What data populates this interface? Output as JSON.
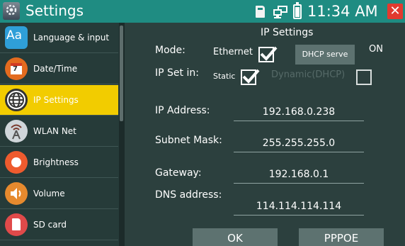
{
  "titlebar": {
    "title": "Settings",
    "time": "11:34 AM",
    "close_symbol": "✕",
    "icons": [
      "settings-app-icon",
      "sd-card-icon",
      "network-icon",
      "battery-icon"
    ]
  },
  "sidebar": {
    "items": [
      {
        "label": "Language & input",
        "icon": "language-icon",
        "active": false
      },
      {
        "label": "Date/Time",
        "icon": "calendar-icon",
        "active": false
      },
      {
        "label": "IP Settings",
        "icon": "globe-icon",
        "active": true
      },
      {
        "label": "WLAN Net",
        "icon": "wlan-icon",
        "active": false
      },
      {
        "label": "Brightness",
        "icon": "brightness-icon",
        "active": false
      },
      {
        "label": "Volume",
        "icon": "volume-icon",
        "active": false
      },
      {
        "label": "SD card",
        "icon": "sd-card-icon",
        "active": false
      }
    ]
  },
  "ip_settings": {
    "title": "IP Settings",
    "mode_label": "Mode:",
    "mode_value": "Ethernet",
    "mode_checked": true,
    "dhcp_serve_label": "DHCP serve",
    "dhcp_serve_state": "ON",
    "ip_set_in_label": "IP Set in:",
    "static_label": "Static",
    "static_checked": true,
    "dynamic_label": "Dynamic(DHCP)",
    "dynamic_checked": false,
    "fields": [
      {
        "label": "IP Address:",
        "value": "192.168.0.238"
      },
      {
        "label": "Subnet Mask:",
        "value": "255.255.255.0"
      },
      {
        "label": "Gateway:",
        "value": "192.168.0.1"
      },
      {
        "label": "DNS address:",
        "value": "114.114.114.114"
      }
    ],
    "ok_label": "OK",
    "pppoe_label": "PPPOE"
  },
  "colors": {
    "titlebar": "#1f8c82",
    "active_item": "#f2cc00",
    "background": "#2c403e",
    "close": "#e23a2f"
  }
}
